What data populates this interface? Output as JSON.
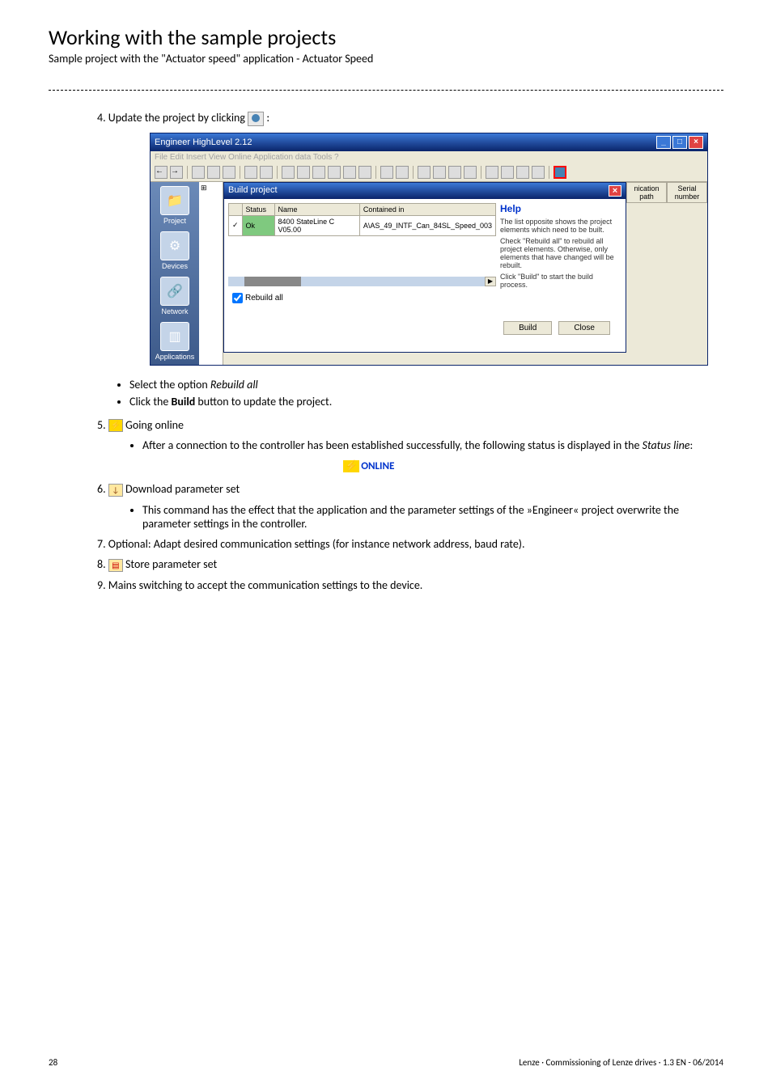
{
  "page": {
    "title": "Working with the sample projects",
    "subtitle": "Sample project with the \"Actuator speed\" application - Actuator Speed",
    "page_number": "28",
    "footer": "Lenze · Commissioning of Lenze drives · 1.3 EN - 06/2014"
  },
  "step4": {
    "label": "4. Update the project by clicking",
    "colon": ":"
  },
  "screenshot": {
    "app_title": "Engineer HighLevel 2.12",
    "menu": "File  Edit  Insert  View  Online  Application data  Tools  ?",
    "dialog": {
      "title": "Build project",
      "columns": {
        "status": "Status",
        "name": "Name",
        "contained": "Contained in"
      },
      "row": {
        "status": "Ok",
        "name": "8400 StateLine C V05.00",
        "contained": "A\\AS_49_INTF_Can_84SL_Speed_003"
      },
      "rebuild_all": "Rebuild all",
      "help_title": "Help",
      "help1": "The list opposite shows the project elements which need to be built.",
      "help2": "Check \"Rebuild all\" to rebuild all project elements. Otherwise, only elements that have changed will be rebuilt.",
      "help3": "Click \"Build\" to start the build process.",
      "build_btn": "Build",
      "close_btn": "Close"
    },
    "nav": {
      "project": "Project",
      "devices": "Devices",
      "network": "Network",
      "applications": "Applications"
    },
    "right_cols": {
      "comm": "nication path",
      "serial": "Serial number"
    }
  },
  "bullets_after_screenshot": {
    "b1": "Select the option ",
    "b1_italic": "Rebuild all",
    "b2_pre": "Click the ",
    "b2_bold": "Build",
    "b2_post": " button to update the project."
  },
  "step5": {
    "label": "5.",
    "title": "Going online",
    "bullet_pre": "After a connection to the controller has been established successfully, the following status is displayed in the ",
    "bullet_italic": "Status line",
    "bullet_post": ":"
  },
  "online_badge": "ONLINE",
  "step6": {
    "label": "6.",
    "title": "Download parameter set",
    "bullet": "This command has the effect that the application and the parameter settings of the »Engineer« project overwrite the parameter settings in the controller."
  },
  "step7": {
    "label": "7. Optional: Adapt desired communication settings (for instance network address, baud rate)."
  },
  "step8": {
    "label": "8.",
    "title": "Store parameter set"
  },
  "step9": {
    "label": "9. Mains switching to accept the communication settings to the device."
  }
}
